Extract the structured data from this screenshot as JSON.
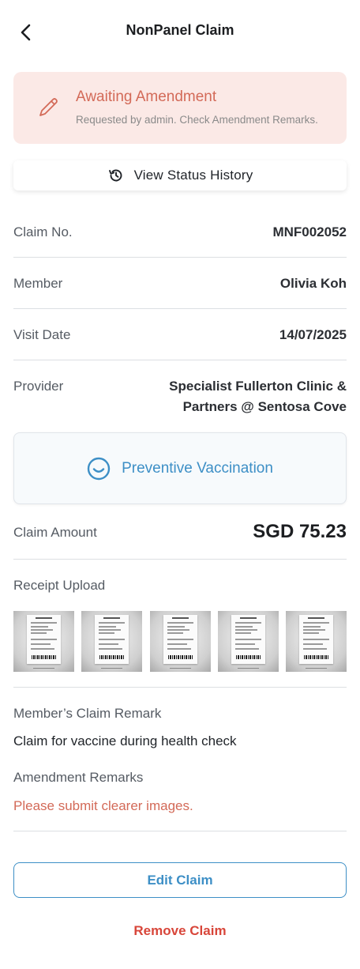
{
  "header": {
    "title": "NonPanel Claim"
  },
  "status": {
    "title": "Awaiting Amendment",
    "subtitle": "Requested by admin. Check Amendment Remarks.",
    "icon": "pencil-icon"
  },
  "history_button": {
    "label": "View Status History",
    "icon": "history-icon"
  },
  "details": {
    "claim_no_label": "Claim No.",
    "claim_no": "MNF002052",
    "member_label": "Member",
    "member": "Olivia Koh",
    "visit_date_label": "Visit Date",
    "visit_date": "14/07/2025",
    "provider_label": "Provider",
    "provider": "Specialist Fullerton Clinic & Partners @ Sentosa Cove"
  },
  "category": {
    "label": "Preventive Vaccination",
    "icon": "smiley-icon"
  },
  "amount": {
    "label": "Claim Amount",
    "value": "SGD 75.23"
  },
  "receipts": {
    "title": "Receipt Upload",
    "count": 5
  },
  "remarks": {
    "member_title": "Member’s Claim Remark",
    "member_text": "Claim for vaccine during health check",
    "amend_title": "Amendment Remarks",
    "amend_text": "Please submit clearer images."
  },
  "actions": {
    "edit_label": "Edit Claim",
    "remove_label": "Remove Claim"
  },
  "colors": {
    "accent": "#3d8fc6",
    "warning": "#d36a58",
    "danger": "#d8463a",
    "status_bg": "#fbe9e6"
  }
}
